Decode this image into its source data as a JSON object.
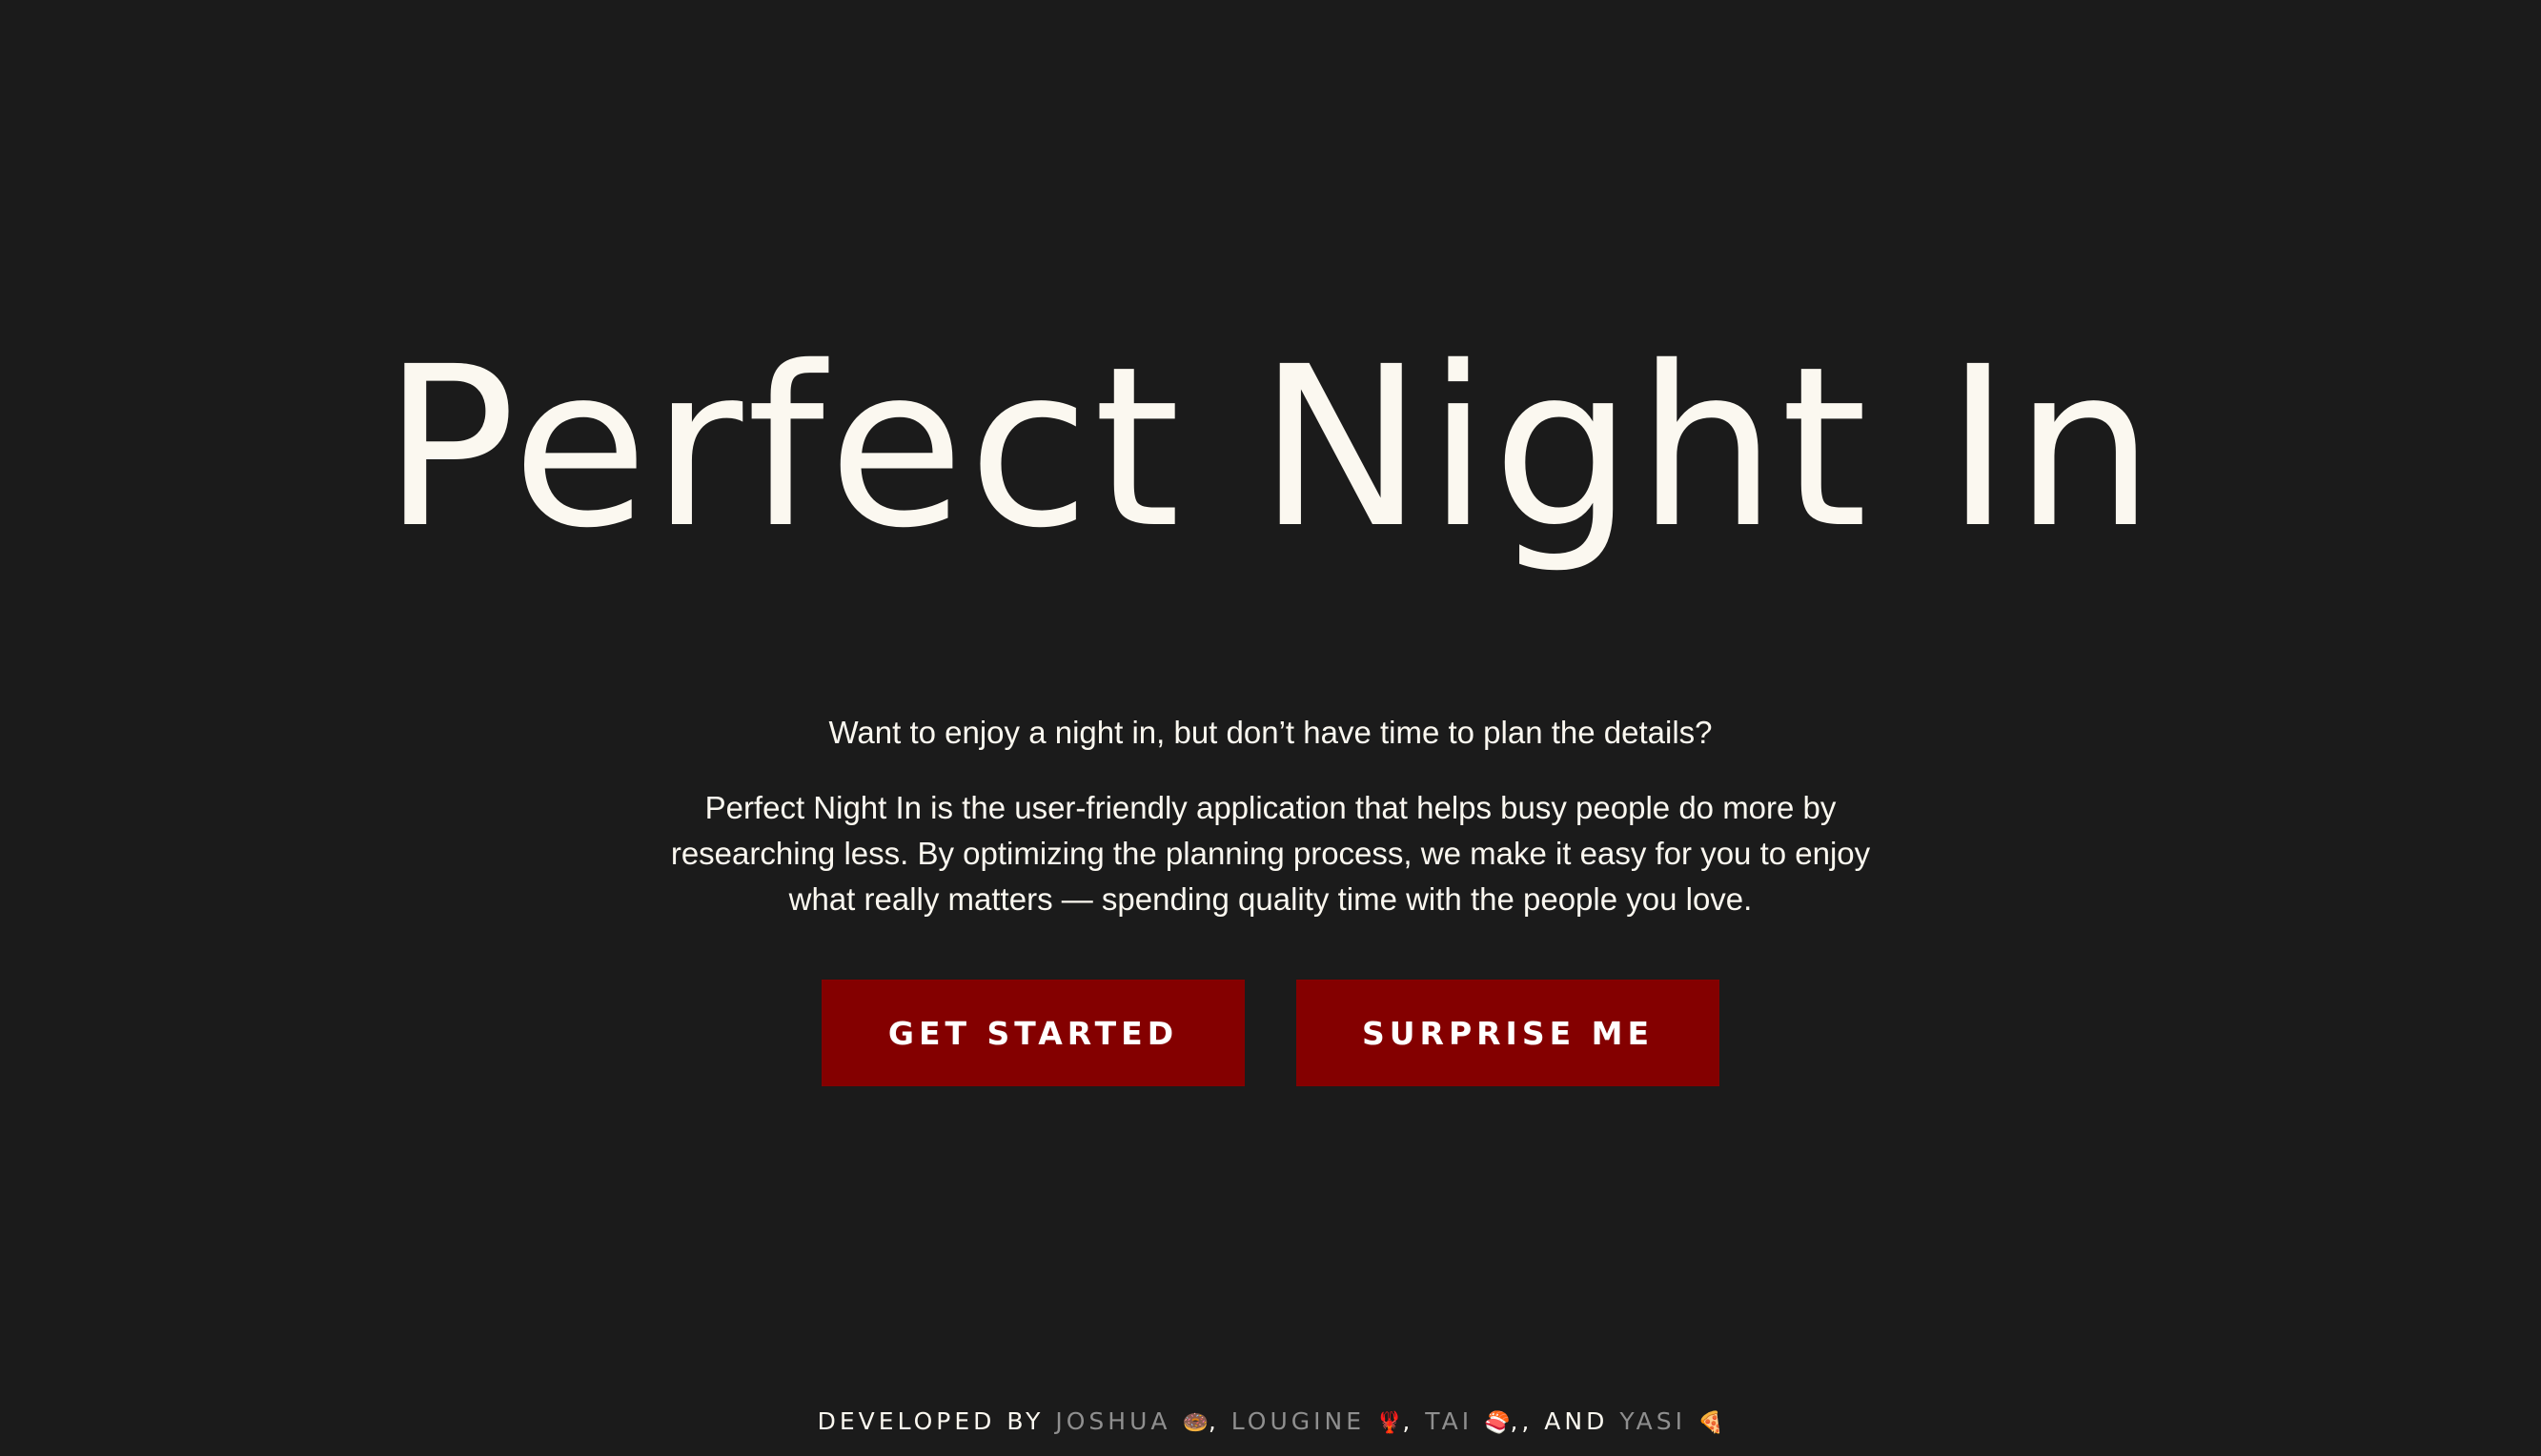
{
  "hero": {
    "title": "Perfect Night In"
  },
  "intro": {
    "tagline": "Want to enjoy a night in, but don’t have time to plan the details?",
    "description": "Perfect Night In is the user-friendly application that helps busy people do more by researching less. By optimizing the planning process, we make it easy for you to enjoy what really matters — spending quality time with the people you love."
  },
  "actions": {
    "get_started_label": "GET STARTED",
    "surprise_me_label": "SURPRISE ME"
  },
  "footer": {
    "prefix": "DEVELOPED BY ",
    "and_label": "AND ",
    "developers": [
      {
        "name": "JOSHUA",
        "emoji": "🍩",
        "separator": ", "
      },
      {
        "name": "LOUGINE",
        "emoji": "🦞",
        "separator": ", "
      },
      {
        "name": "TAI",
        "emoji": "🍣",
        "separator": ",, "
      },
      {
        "name": "YASI",
        "emoji": "🍕",
        "separator": ""
      }
    ]
  },
  "colors": {
    "background": "#1b1b1b",
    "text": "#fbf8f0",
    "button": "#840000",
    "developer_name": "#8f8f8f"
  }
}
